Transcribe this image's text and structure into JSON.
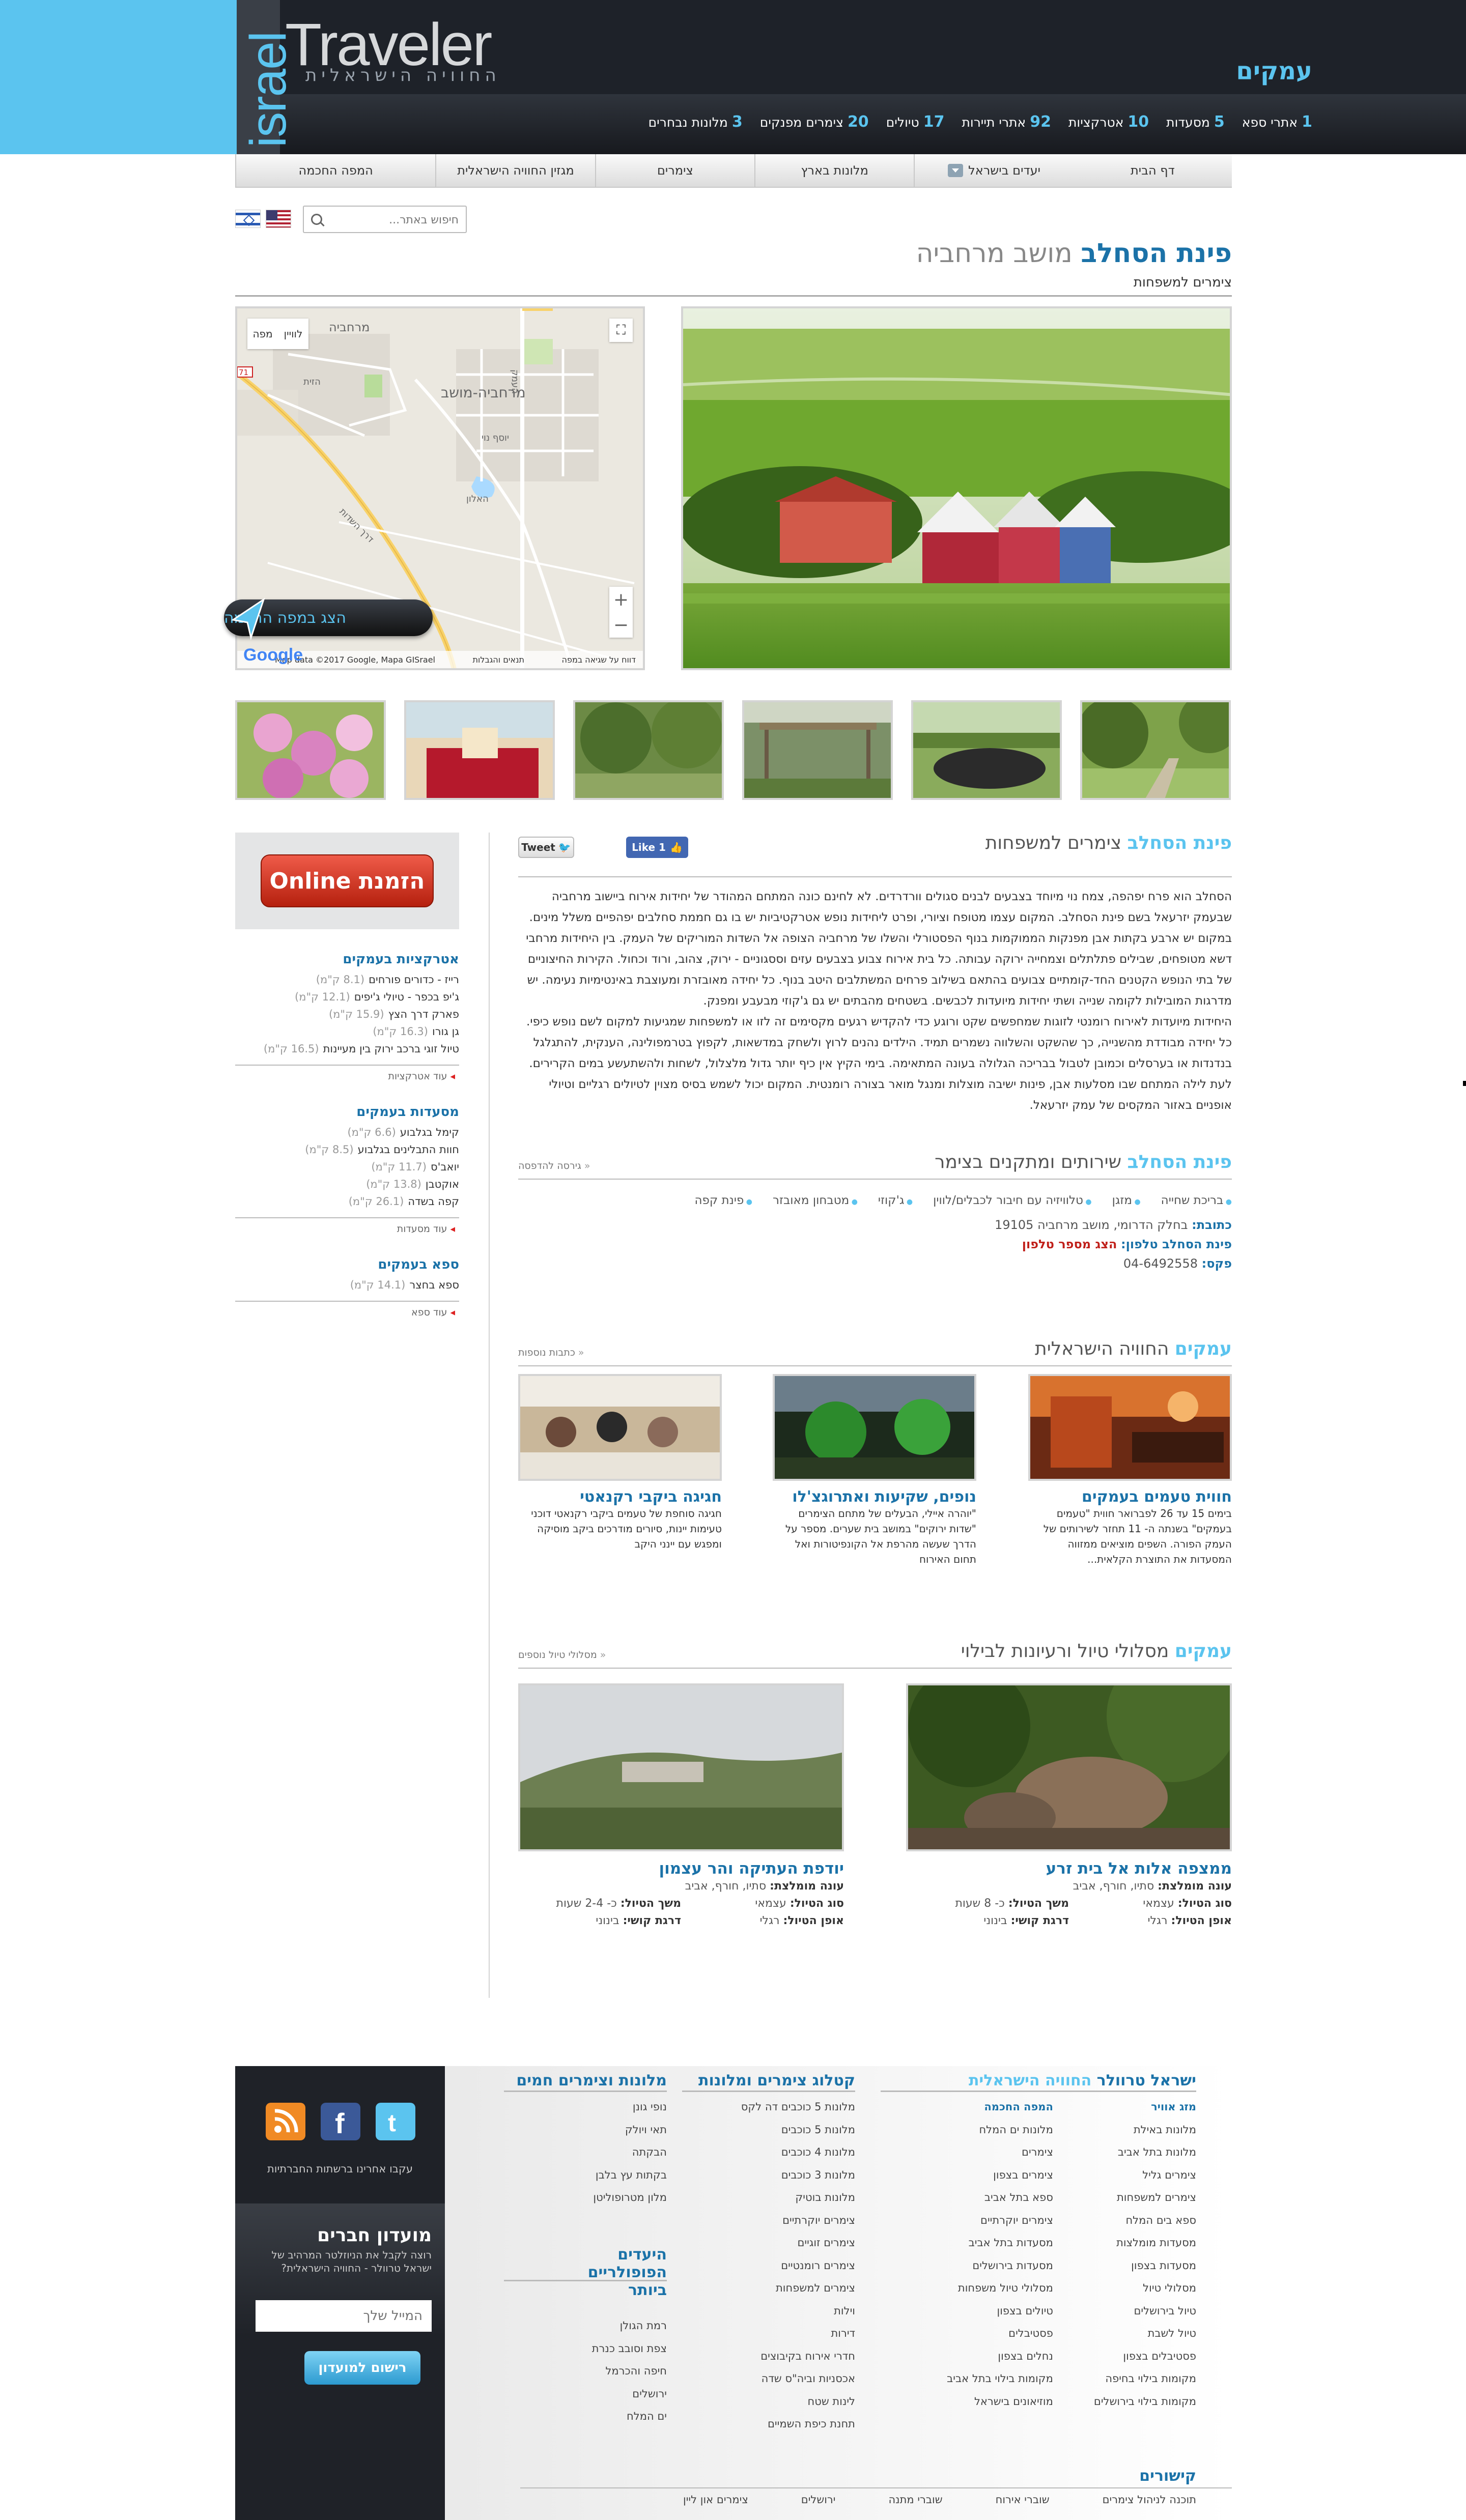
{
  "header": {
    "logo_israel": "israel",
    "logo_traveler": "Traveler",
    "logo_sub": "החוויה הישראלית",
    "region": "עמקים",
    "stats": [
      {
        "num": "3",
        "label": "מלונות נבחרים"
      },
      {
        "num": "20",
        "label": "צימרים מפנקים"
      },
      {
        "num": "17",
        "label": "טיולים"
      },
      {
        "num": "92",
        "label": "אתרי תיירות"
      },
      {
        "num": "10",
        "label": "אטרקציות"
      },
      {
        "num": "5",
        "label": "מסעדות"
      },
      {
        "num": "1",
        "label": "אתרי ספא"
      }
    ]
  },
  "nav": {
    "items": [
      "דף הבית",
      "יעדים בישראל",
      "מלונות בארץ",
      "צימרים",
      "מגזין החוויה הישראלית",
      "המפה החכמה"
    ]
  },
  "search": {
    "placeholder": "חיפוש באתר..."
  },
  "page": {
    "name": "פינת הסחלב",
    "location": "מושב מרחביה",
    "category": "צימרים למשפחות"
  },
  "map": {
    "toggle_map": "מפה",
    "toggle_sat": "לוויין",
    "labels": [
      "מרחביה",
      "מרחביה-מושב",
      "דרך השדות",
      "יוסף נוי",
      "העמק",
      "הזית",
      "האלון",
      "71"
    ],
    "footer_data": "Map data ©2017 Google, Mapa GISrael",
    "footer_terms": "תנאים והגבלות",
    "footer_report": "דווח על שגיאה במפה",
    "google": "Google",
    "show_btn": "הצג במפה החכמה"
  },
  "booking": {
    "label": "הזמנת Online"
  },
  "sidebar": {
    "attractions": {
      "title": "אטרקציות בעמקים",
      "items": [
        {
          "name": "רייז - כדורים פורחים",
          "dist": "(8.1 ק\"מ)"
        },
        {
          "name": "ג'יפ בכפר - טיולי ג'יפים",
          "dist": "(12.1 ק\"מ)"
        },
        {
          "name": "פארק דרך הצץ",
          "dist": "(15.9 ק\"מ)"
        },
        {
          "name": "גן גורו",
          "dist": "(16.3 ק\"מ)"
        },
        {
          "name": "טיול זוגי ברכב ירוק בין מעיינות",
          "dist": "(16.5 ק\"מ)"
        }
      ],
      "more": "עוד אטרקציות"
    },
    "restaurants": {
      "title": "מסעדות בעמקים",
      "items": [
        {
          "name": "קימל בגלבוע",
          "dist": "(6.6 ק\"מ)"
        },
        {
          "name": "חוות התבלינים בגלבוע",
          "dist": "(8.5 ק\"מ)"
        },
        {
          "name": "יואב'ס",
          "dist": "(11.7 ק\"מ)"
        },
        {
          "name": "אוקטבן",
          "dist": "(13.8 ק\"מ)"
        },
        {
          "name": "קפה בשדה",
          "dist": "(26.1 ק\"מ)"
        }
      ],
      "more": "עוד מסעדות"
    },
    "spa": {
      "title": "ספא בעמקים",
      "items": [
        {
          "name": "ספא בחצר",
          "dist": "(14.1 ק\"מ)"
        }
      ],
      "more": "עוד ספא"
    }
  },
  "about": {
    "name": "פינת הסחלב",
    "category": "צימרים למשפחות",
    "tweet": "Tweet",
    "like": "Like 1",
    "text": [
      "הסחלב הוא פרח יפהפה, צמח נוי מיוחד בצבעים לבנים סגולים וורדרדים. לא לחינם כונה המתחם המהודר של יחידות אירוח ביישוב מרחביה שבעמק יזרעאל בשם פינת הסחלב. המקום עצמו מטופח וציורי, ופרט ליחידות נופש אטרקטיביות יש בו גם חממת סחלבים יפהפיים משלל מינים. במקום יש ארבע בקתות אבן מפנקות הממוקמות בנוף הפסטורלי והשלו של מרחביה הצופה אל השדות המוריקים של העמק. בין היחידות מרחבי דשא מטופחים, שבילים פתלתלים וצמחייה ירוקה עבותה. כל בית אירוח צבוע בצבעים עזים וססגוניים - ירוק, צהוב, ורוד וכחול. הקירות החיצוניים של בתי הנופש הקטנים החד-קומתיים צבועים בהתאם בשילוב פרחים המשתלבים היטב בנוף. כל יחידה מאובזרת ומעוצבת באינטימיות נעימה. יש מדרגות המובילות לקומה שנייה ושתי יחידות מיועדות לכבשים. בשטחים מהבתים יש גם ג'קוזי מבעבע ומפנק.",
      "היחידות מיועדות לאירוח רומנטי לזוגות שמחפשים שקט ורוגע כדי להקדיש רגעים מקסימים זה לזו או למשפחות שמגיעות למקום לשם נופש כיפי. כל יחידה מבודדת מהשנייה, כך שהשקט והשלווה נשמרים תמיד. הילדים נהנים לרוץ ולשחק במדשאות, לקפוץ בטרמפולינה, הענקית, להתגלגל בנדנדות או בערסלים וכמובן לטבול בבריכה הגלולה בעונה המתאימה. בימי הקיץ אין כיף יותר גדול מלצלול, לשחות ולהשתעשע במים הקרירים. לעת לילה המתחם שבו מסלעות אבן, פינות ישיבה מוצלות ומנגל מואר בצורה רומנטית. המקום יכול לשמש בסיס מצוין לטיולים רגליים וטיולי אופניים באזור המקסים של עמק יזרעאל."
    ]
  },
  "services": {
    "name": "פינת הסחלב",
    "title": "שירותים ומתקנים בצימר",
    "print": "גירסה להדפסה",
    "amenities": [
      "בריכת שחייה",
      "מזגן",
      "טלוויזיה עם חיבור לכבלים/לווין",
      "ג'קוזי",
      "מטבחון מאובזר",
      "פינת קפה"
    ],
    "address_label": "כתובת:",
    "address": "בחלק הדרומי, מושב מרחביה 19105",
    "phone_label": "פינת הסחלב טלפון:",
    "phone_link": "הצג מספר טלפון",
    "fax_label": "פקס:",
    "fax": "04-6492558"
  },
  "experience": {
    "region": "עמקים",
    "title": "החוויה הישראלית",
    "more": "כתבות נוספות",
    "articles": [
      {
        "title": "חווית טעמים בעמקים",
        "text": "בימים 15 עד 26 לפברואר חווית \"טעמים בעמקים\" בשנתה ה- 11 תחזר לשירותים של העמק הפורה. השפים מוציאים ממזווה המסעדות את התוצרת הקלאית...",
        "more": ""
      },
      {
        "title": "נופים, שקיעות ואתרוגצ'לו",
        "text": "\"יוהרה איילי, הבעלים של מתחם הצימרים \"שדות ירוקים\" במושב בית שערים. מספר על הדרך שעשה מהרפת אל הקונפיטורות ואל תחום האירוח",
        "more": ""
      },
      {
        "title": "חגיגה ביקבי רקנאטי",
        "text": "חגיגה סוחפת של טעמים ביקבי רקנאטי דוכני טעימות יינות, סיורים מודרכים ביקב מוסיקה ומפגש עם יינני היקב",
        "more": ""
      }
    ]
  },
  "trails": {
    "region": "עמקים",
    "title": "מסלולי טיול ורעיונות לבילוי",
    "more": "מסלולי טיול נוספים",
    "items": [
      {
        "title": "ממצפה אלות אל בית זרע",
        "season_l": "עונה מומלצת:",
        "season": "סתיו, חורף, אביב",
        "type_l": "סוג הטיול:",
        "type": "עצמאי",
        "dur_l": "משך הטיול:",
        "dur": "כ- 8 שעות",
        "mode_l": "אופן הטיול:",
        "mode": "רגלי",
        "diff_l": "דרגת קושי:",
        "diff": "בינוני"
      },
      {
        "title": "יודפת העתיקה והר עצמון",
        "season_l": "עונה מומלצת:",
        "season": "סתיו, חורף, אביב",
        "type_l": "סוג הטיול:",
        "type": "עצמאי",
        "dur_l": "משך הטיול:",
        "dur": "כ- 2-4 שעות",
        "mode_l": "אופן הטיול:",
        "mode": "רגלי",
        "diff_l": "דרגת קושי:",
        "diff": "בינוני"
      }
    ]
  },
  "footer": {
    "follow": "עקבו אחרינו ברשתות החברתיות",
    "club_title": "מועדון חברים",
    "club_text": "רוצה לקבל את הניוזלטר המרהיב של ישראל טרוולר - החוויה הישראלית?",
    "club_placeholder": "המייל שלך",
    "club_button": "רישום למועדון",
    "col1": {
      "title_a": "ישראל טרוולר",
      "title_b": "החוויה הישראלית",
      "a": [
        "מזג אוויר",
        "מלונות באילת",
        "מלונות בתל אביב",
        "צימרים גליל",
        "צימרים למשפחות",
        "ספא בים המלח",
        "מסעדות מומלצות",
        "מסעדות בצפון",
        "מסלולי טיול",
        "טיול בירושלים",
        "טיול לשבת",
        "פסטיבלים בצפון",
        "מקומות בילוי בחיפה",
        "מקומות בילוי בירושלים"
      ],
      "b": [
        "המפה החכמה",
        "מלונות ים המלח",
        "צימרים",
        "צימרים בצפון",
        "ספא בתל אביב",
        "צימרים יוקרתיים",
        "מסעדות בתל אביב",
        "מסעדות בירושלים",
        "מסלולי טיול משפחות",
        "טיולים בצפון",
        "פסטיבלים",
        "נחלים בצפון",
        "מקומות בילוי בתל אביב",
        "מוזיאונים בישראל"
      ]
    },
    "col2": {
      "title": "קטלוג צימרים ומלונות",
      "items": [
        "מלונות 5 כוכבים דה לקס",
        "מלונות 5 כוכבים",
        "מלונות 4 כוכבים",
        "מלונות 3 כוכבים",
        "מלונות בוטיק",
        "צימרים יוקרתיים",
        "צימרים זוגיים",
        "צימרים רומנטיים",
        "צימרים למשפחות",
        "וילות",
        "דירות",
        "חדרי אירוח בקיבוצים",
        "אכסניות וביה\"ס שדה",
        "לינות שטח",
        "תחנת כיפת השמיים"
      ]
    },
    "col3": {
      "title": "מלונות וצימרים חמים",
      "items": [
        "נופי גונן",
        "תאי ויולק",
        "הבקתה",
        "בקתות עץ בלבן",
        "מלון מטרופוליטן"
      ]
    },
    "col4": {
      "title": "היעדים הפופולריים ביותר",
      "items": [
        "רמת הגולן",
        "צפת וסובב כנרת",
        "חיפה והכרמל",
        "ירושלים",
        "ים המלח"
      ]
    },
    "links_title": "קישורים",
    "links": [
      "צימרים און ליין",
      "ירושלים",
      "שוברי מתנה",
      "שוברי אירוח",
      "תוכנה לניהול צימרים"
    ]
  }
}
